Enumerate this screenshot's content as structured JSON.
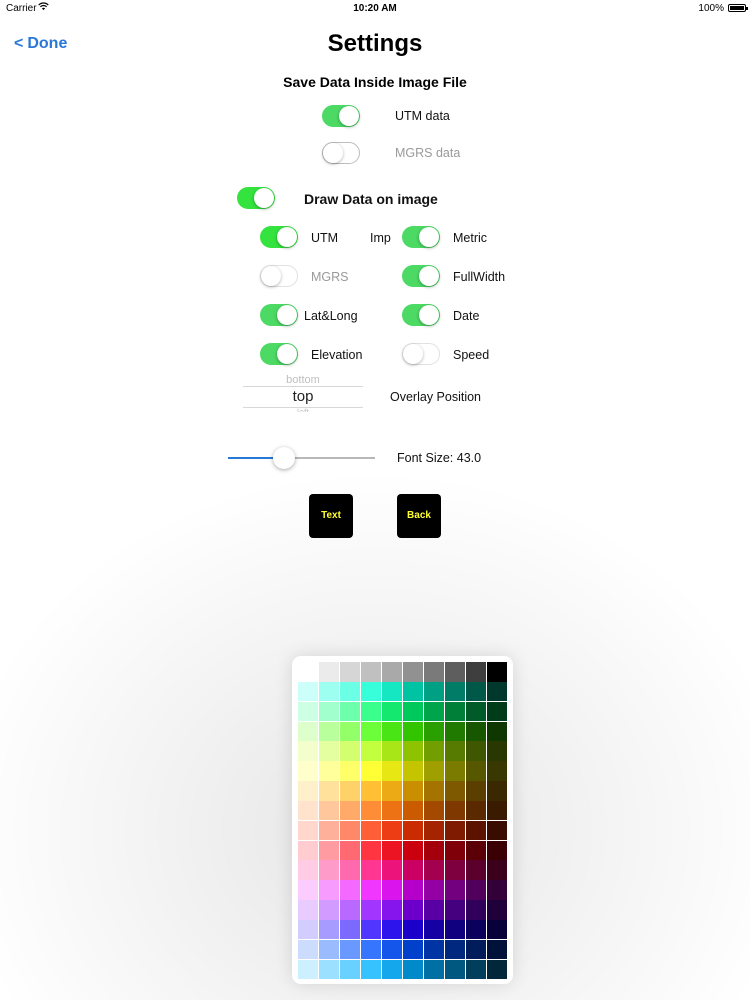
{
  "status_bar": {
    "carrier": "Carrier",
    "time": "10:20 AM",
    "battery": "100%"
  },
  "nav": {
    "back_label": "Done",
    "back_chevron": "<",
    "title": "Settings"
  },
  "save_section": {
    "heading": "Save Data Inside Image File",
    "utm": {
      "label": "UTM data",
      "on": true
    },
    "mgrs": {
      "label": "MGRS data",
      "on": false
    }
  },
  "draw_section": {
    "label": "Draw Data on image",
    "on": true
  },
  "options": {
    "utm": {
      "label": "UTM",
      "on": true
    },
    "imp": {
      "label": "Imp"
    },
    "metric": {
      "label": "Metric",
      "on": true
    },
    "mgrs": {
      "label": "MGRS",
      "on": false
    },
    "fullwidth": {
      "label": "FullWidth",
      "on": true
    },
    "latlong": {
      "label": "Lat&Long",
      "on": true
    },
    "date": {
      "label": "Date",
      "on": true
    },
    "elevation": {
      "label": "Elevation",
      "on": true
    },
    "speed": {
      "label": "Speed",
      "on": false
    }
  },
  "position_picker": {
    "previous": "bottom",
    "selected": "top",
    "next": "left",
    "label": "Overlay Position"
  },
  "font_slider": {
    "label": "Font Size: 43.0",
    "fraction": 0.38
  },
  "buttons": {
    "text_label": "Text",
    "back_label": "Back"
  },
  "color_palette": {
    "columns": 10,
    "colors": [
      "#ffffff",
      "#ebebeb",
      "#d6d6d6",
      "#c0c0c0",
      "#a9a9a9",
      "#919191",
      "#7a7a7a",
      "#5e5e5e",
      "#3e3e3e",
      "#000000",
      "#cdfffa",
      "#9cfff0",
      "#6bffe6",
      "#36ffd9",
      "#16e7c3",
      "#00c3a3",
      "#00a085",
      "#007c67",
      "#005849",
      "#00382e",
      "#ccffe4",
      "#a0ffcc",
      "#6dffac",
      "#3bff8c",
      "#14e86e",
      "#00c95b",
      "#00a44a",
      "#007f38",
      "#005b28",
      "#003b1a",
      "#dcffcc",
      "#b9ff9c",
      "#93ff69",
      "#6cff39",
      "#4ae515",
      "#33c400",
      "#2a9f00",
      "#207a00",
      "#165700",
      "#0e3800",
      "#f2ffcc",
      "#e4ff9f",
      "#d3ff6f",
      "#c2ff3e",
      "#a8e618",
      "#8dc300",
      "#729e00",
      "#577a00",
      "#3e5700",
      "#283800",
      "#ffffcc",
      "#ffff9b",
      "#ffff69",
      "#ffff36",
      "#e7e714",
      "#c4c400",
      "#9f9f00",
      "#7b7b00",
      "#575700",
      "#383800",
      "#fff0cc",
      "#ffe19b",
      "#ffd169",
      "#ffc036",
      "#ecab14",
      "#ca8f00",
      "#a47300",
      "#7f5900",
      "#5b3f00",
      "#3a2900",
      "#ffe3cc",
      "#ffc79b",
      "#ffaa69",
      "#ff8c36",
      "#ec7214",
      "#ca5b00",
      "#a44a00",
      "#7f3900",
      "#5b2900",
      "#3a1a00",
      "#ffd7cc",
      "#ffb09b",
      "#ff8869",
      "#ff5f36",
      "#ec3d14",
      "#ca2b00",
      "#a42300",
      "#7f1b00",
      "#5b1300",
      "#3a0c00",
      "#ffcccf",
      "#ff9ba1",
      "#ff6972",
      "#ff3642",
      "#ec1422",
      "#ca000f",
      "#a4000c",
      "#7f0009",
      "#5b0007",
      "#3a0004",
      "#ffcce4",
      "#ff9bc9",
      "#ff69ae",
      "#ff3692",
      "#ec147a",
      "#ca0063",
      "#a40050",
      "#7f003e",
      "#5b002c",
      "#3a001c",
      "#fcccff",
      "#f89bff",
      "#f469ff",
      "#f036ff",
      "#d914ec",
      "#b500ca",
      "#9300a4",
      "#72007f",
      "#51005b",
      "#33003a",
      "#e8ccff",
      "#d19bff",
      "#b969ff",
      "#a036ff",
      "#8614ec",
      "#6c00ca",
      "#5800a4",
      "#44007f",
      "#31005b",
      "#1f003a",
      "#d3ccff",
      "#a89bff",
      "#7c69ff",
      "#5036ff",
      "#2e14ec",
      "#1a00ca",
      "#1500a4",
      "#10007f",
      "#0b005b",
      "#07003a",
      "#ccdcff",
      "#9bbbff",
      "#6998ff",
      "#3676ff",
      "#1456ec",
      "#0040ca",
      "#0033a4",
      "#00287f",
      "#001c5b",
      "#00123a",
      "#ccf0ff",
      "#9be1ff",
      "#69d1ff",
      "#36c1ff",
      "#14a7ec",
      "#008aca",
      "#0070a4",
      "#00577f",
      "#003e5b",
      "#00283a"
    ]
  }
}
